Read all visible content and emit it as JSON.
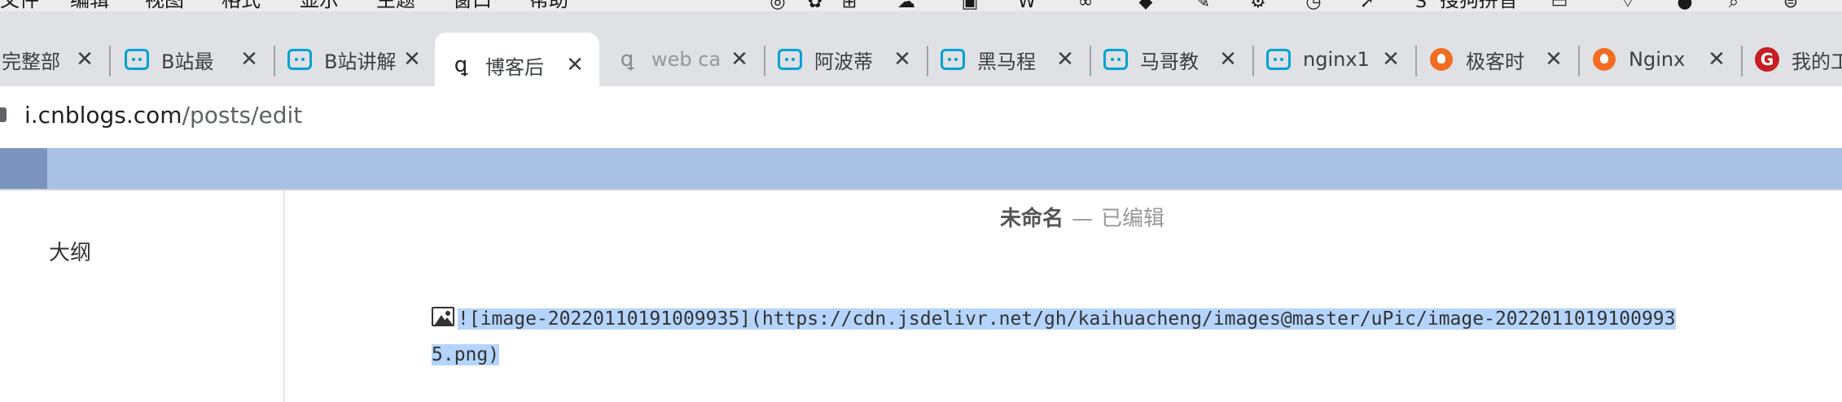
{
  "menubar": {
    "items": [
      "文件",
      "编辑",
      "视图",
      "格式",
      "显示",
      "主题",
      "窗口",
      "帮助"
    ],
    "tray": {
      "input_method_label": "搜狗拼音"
    }
  },
  "tabs": [
    {
      "title": "完整部",
      "favicon": "cropped-favicon",
      "active": false,
      "faded": false
    },
    {
      "title": "B站最",
      "favicon": "bilibili-icon",
      "active": false,
      "faded": false
    },
    {
      "title": "B站讲解",
      "favicon": "bilibili-icon",
      "active": false,
      "faded": false
    },
    {
      "title": "博客后",
      "favicon": "cnblogs-icon",
      "active": true,
      "faded": false
    },
    {
      "title": "web ca",
      "favicon": "cnblogs-icon",
      "active": false,
      "faded": true
    },
    {
      "title": "阿波蒂",
      "favicon": "bilibili-icon",
      "active": false,
      "faded": false
    },
    {
      "title": "黑马程",
      "favicon": "bilibili-icon",
      "active": false,
      "faded": false
    },
    {
      "title": "马哥教",
      "favicon": "bilibili-icon",
      "active": false,
      "faded": false
    },
    {
      "title": "nginx1",
      "favicon": "bilibili-icon",
      "active": false,
      "faded": false
    },
    {
      "title": "极客时",
      "favicon": "geekbang-icon",
      "active": false,
      "faded": false
    },
    {
      "title": "Nginx",
      "favicon": "geekbang-icon",
      "active": false,
      "faded": false
    },
    {
      "title": "我的工",
      "favicon": "gitee-icon",
      "active": false,
      "faded": false
    }
  ],
  "addressbar": {
    "host": "i.cnblogs.com",
    "path": "/posts/edit"
  },
  "sidebar": {
    "outline_title": "大纲"
  },
  "editor": {
    "doc_title": "未命名",
    "doc_dash": "—",
    "doc_state": "已编辑",
    "line1": "![image-20220110191009935](https://cdn.jsdelivr.net/gh/kaihuacheng/images@master/uPic/image-2022011019100993",
    "line2": "5.png)"
  },
  "colors": {
    "toolbar": "#a9c1e3",
    "selection": "#b4d4fb",
    "tabstrip": "#dfe1e5"
  }
}
